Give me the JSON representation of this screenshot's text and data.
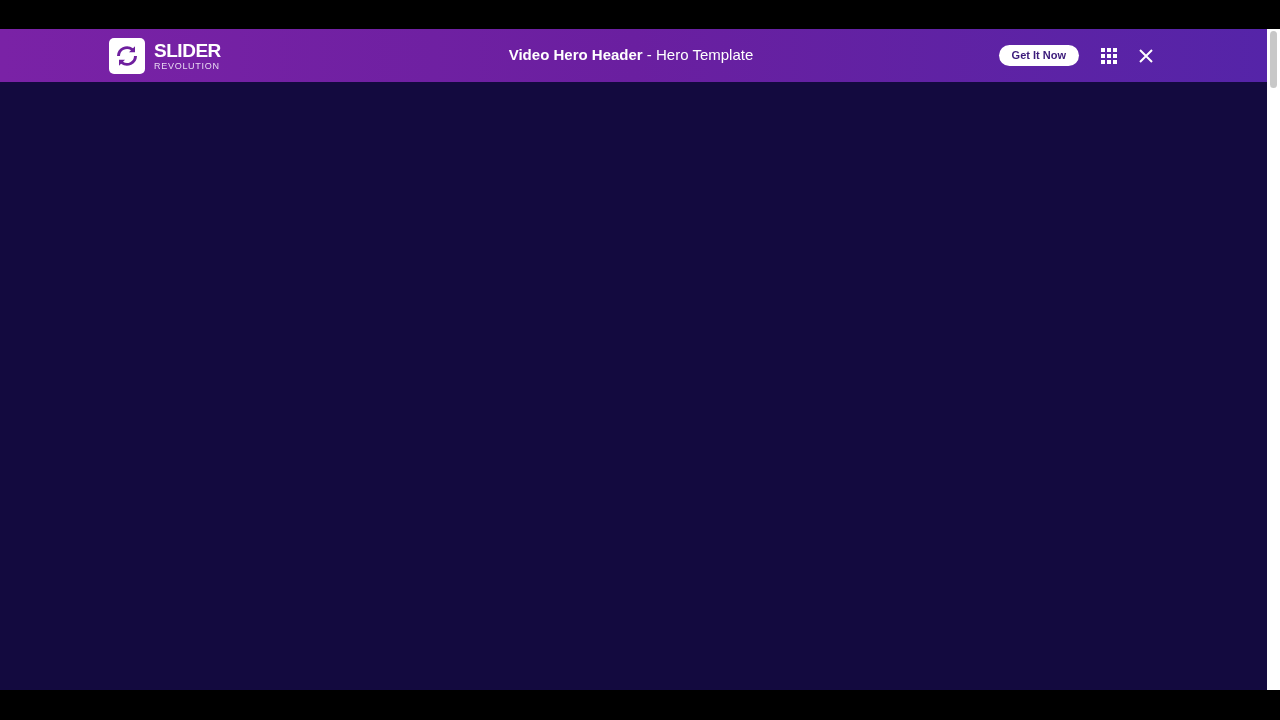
{
  "header": {
    "logo": {
      "name": "SLIDER",
      "tagline": "REVOLUTION"
    },
    "title": "**Video Hero Header** - Hero Template",
    "cta": "Get It Now"
  }
}
